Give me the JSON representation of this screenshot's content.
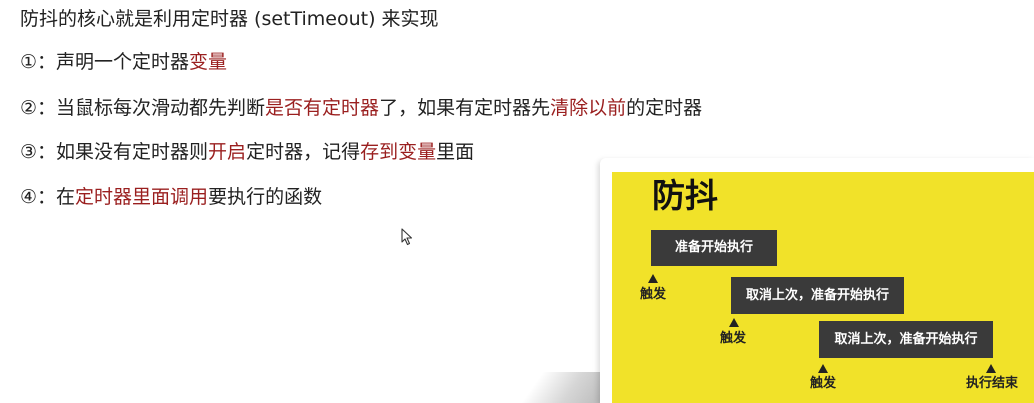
{
  "notes": {
    "line1": {
      "a": "防抖的核心就是利用定时器 (setTimeout) 来实现"
    },
    "line2": {
      "a": "①：声明一个定时器",
      "b": "变量"
    },
    "line3": {
      "a": "②：当鼠标每次滑动都先判断",
      "b": "是否有定时器",
      "c": "了，如果有定时器先",
      "d": "清除以前",
      "e": "的定时器"
    },
    "line4": {
      "a": "③：如果没有定时器则",
      "b": "开启",
      "c": "定时器，记得",
      "d": "存到变量",
      "e": "里面"
    },
    "line5": {
      "a": "④：在",
      "b": "定时器里面调用",
      "c": "要执行的函数"
    }
  },
  "slide": {
    "title": "防抖",
    "box1": "准备开始执行",
    "box2": "取消上次，准备开始执行",
    "box3": "取消上次，准备开始执行",
    "trigger1": "触发",
    "trigger2": "触发",
    "trigger3": "触发",
    "end": "执行结束"
  },
  "colors": {
    "highlight": "#9a1f1f",
    "slide_bg": "#f1e229",
    "box_bg": "#3a3a3a"
  },
  "icons": {
    "cursor": "mouse-pointer-icon",
    "arrow": "triangle-up-icon"
  }
}
